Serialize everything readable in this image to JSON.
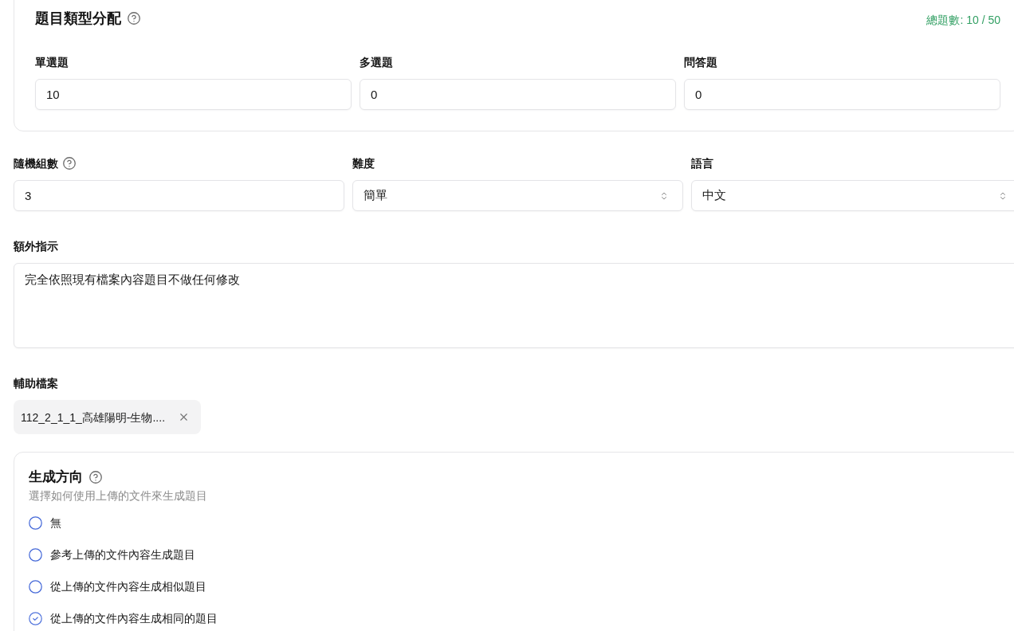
{
  "question_types": {
    "title": "題目類型分配",
    "help": true,
    "total": "總題數: 10 / 50",
    "fields": [
      {
        "label": "單選題",
        "value": "10"
      },
      {
        "label": "多選題",
        "value": "0"
      },
      {
        "label": "問答題",
        "value": "0"
      }
    ]
  },
  "settings": [
    {
      "kind": "input",
      "label": "隨機組數",
      "help": true,
      "value": "3"
    },
    {
      "kind": "select",
      "label": "難度",
      "help": false,
      "value": "簡單"
    },
    {
      "kind": "select",
      "label": "語言",
      "help": false,
      "value": "中文"
    }
  ],
  "instructions": {
    "label": "額外指示",
    "value": "完全依照現有檔案內容題目不做任何修改"
  },
  "attachments": {
    "label": "輔助檔案",
    "files": [
      {
        "name": "112_2_1_1_高雄陽明-生物...."
      }
    ]
  },
  "generation_direction": {
    "title": "生成方向",
    "help": true,
    "subtitle": "選擇如何使用上傳的文件來生成題目",
    "options": [
      {
        "label": "無",
        "selected": false
      },
      {
        "label": "參考上傳的文件內容生成題目",
        "selected": false
      },
      {
        "label": "從上傳的文件內容生成相似題目",
        "selected": false
      },
      {
        "label": "從上傳的文件內容生成相同的題目",
        "selected": true
      }
    ]
  }
}
